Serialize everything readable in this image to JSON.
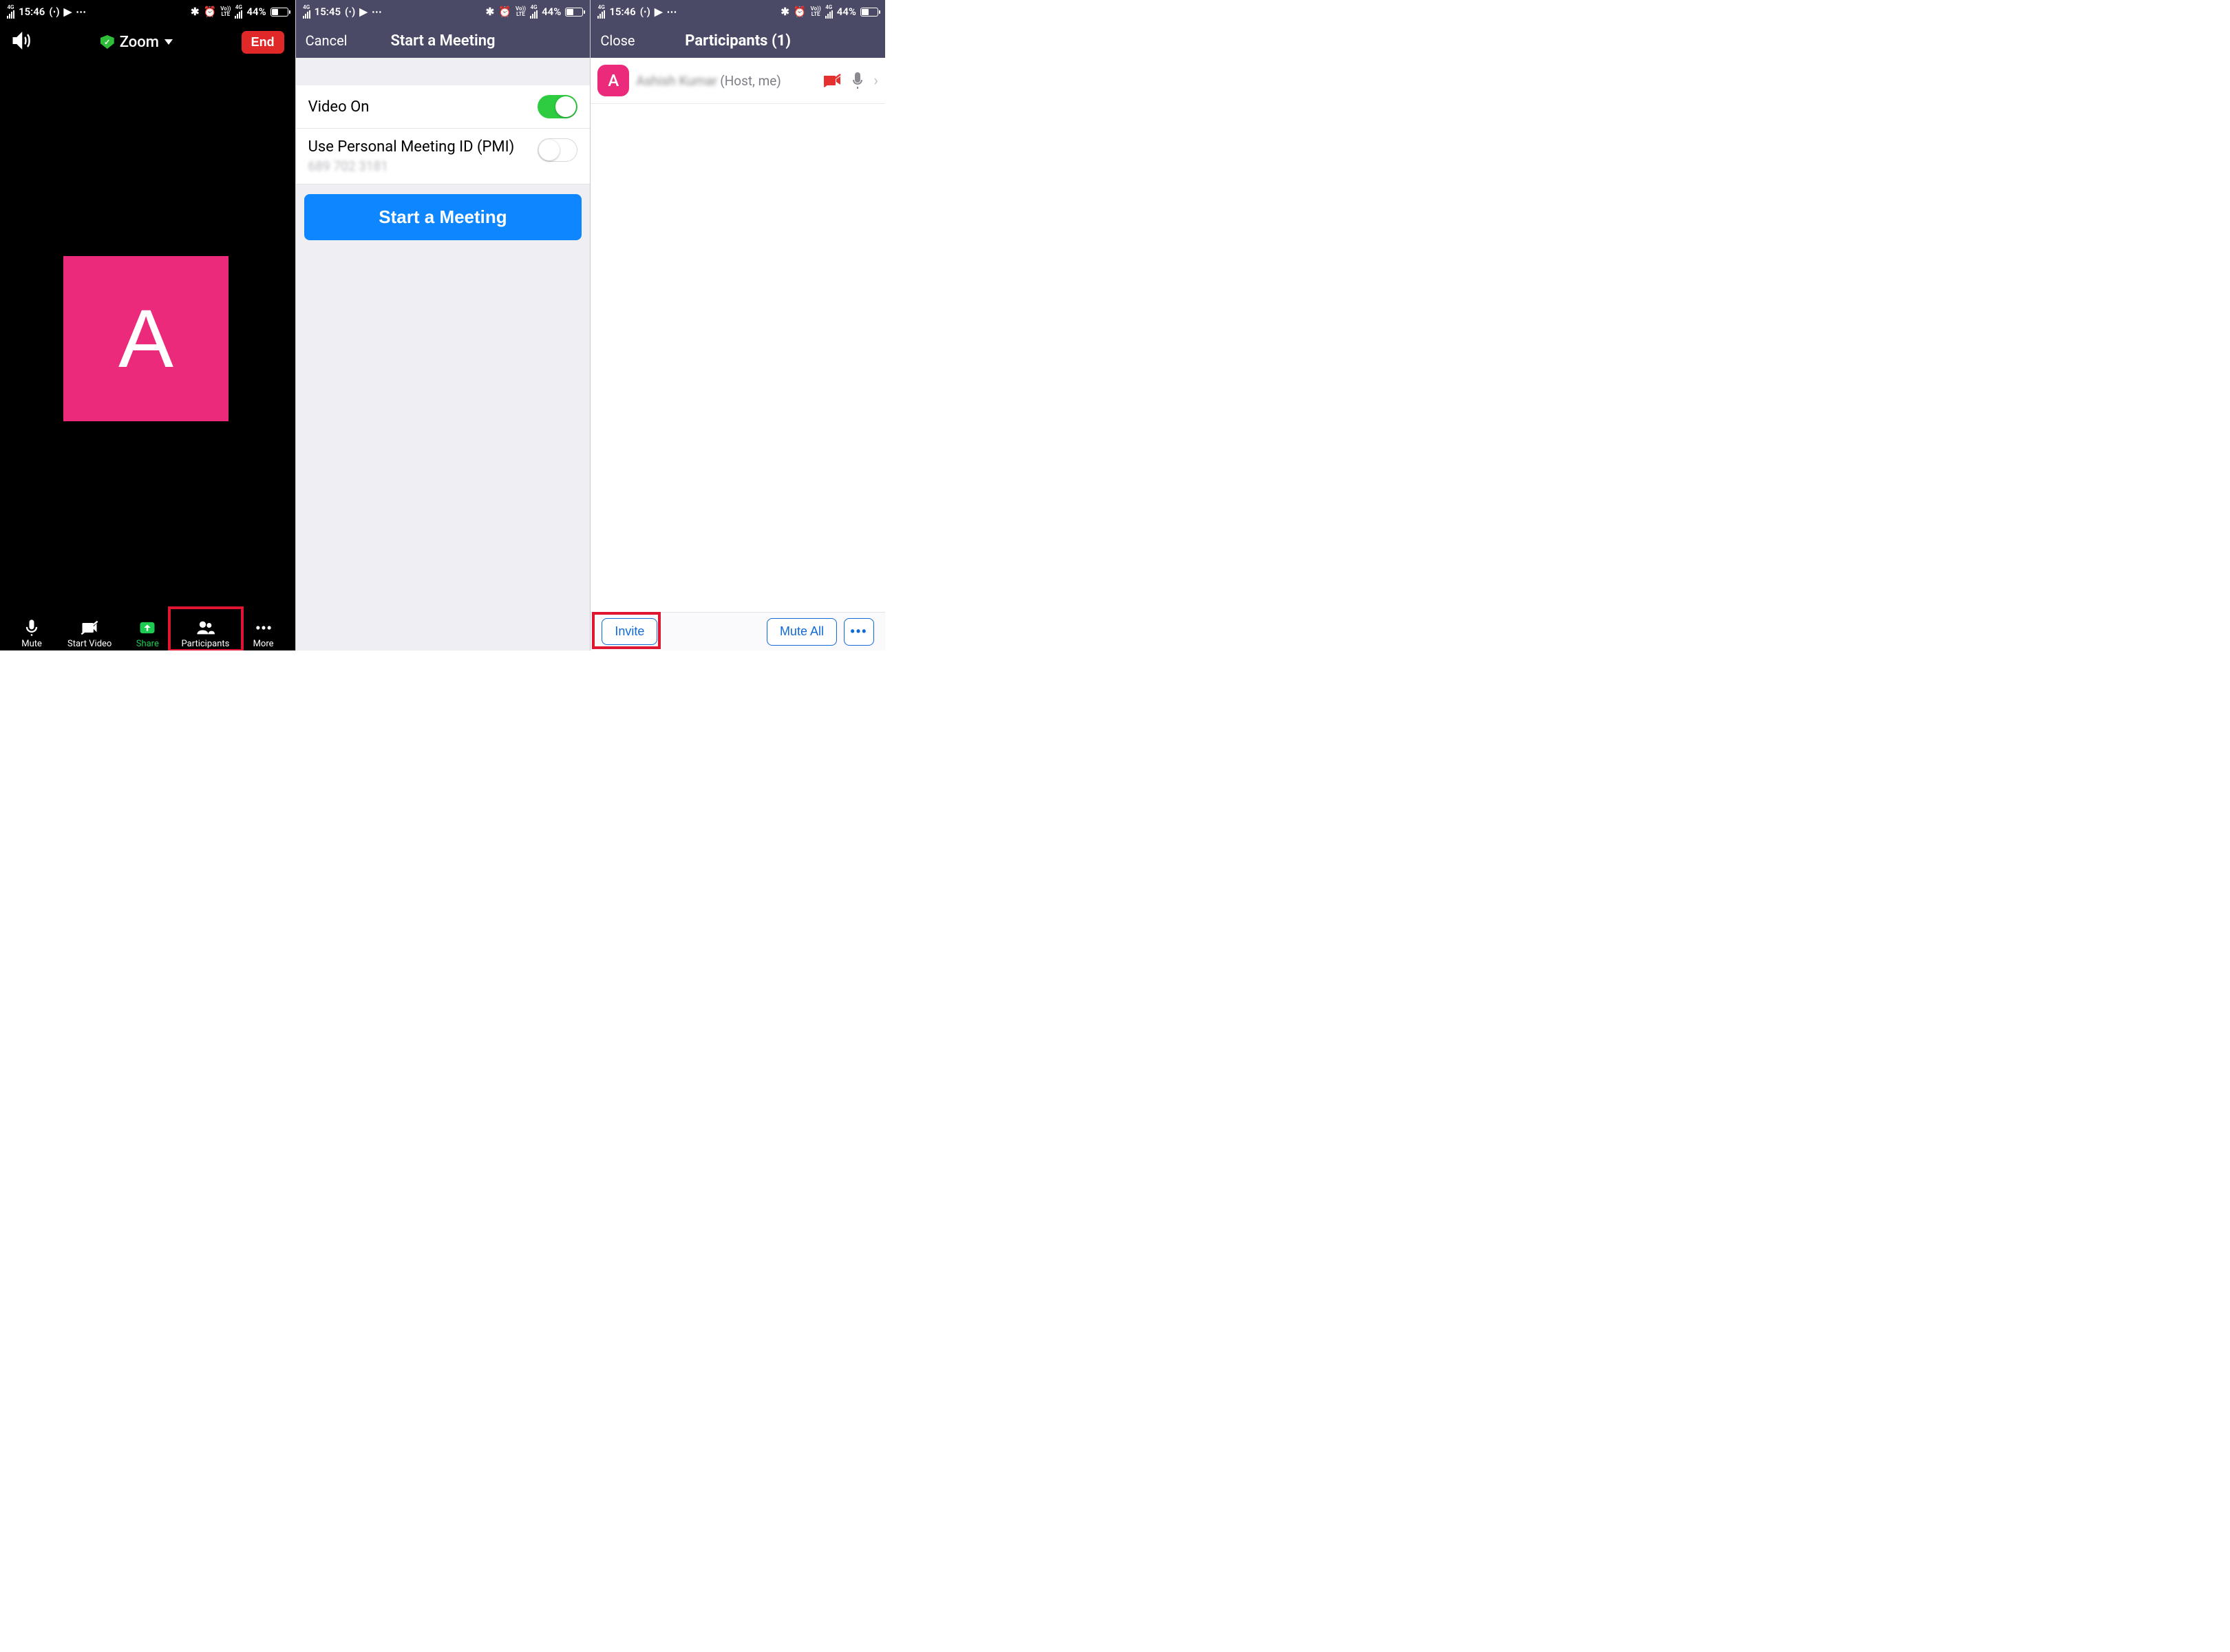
{
  "status": {
    "net_label": "4G",
    "time1": "15:46",
    "time2": "15:45",
    "time3": "15:46",
    "battery_text": "44%",
    "lte_top": "Vo))",
    "lte_bottom": "LTE",
    "net2_top": "4G"
  },
  "p1": {
    "title": "Zoom",
    "end": "End",
    "avatar_letter": "A",
    "toolbar": {
      "mute": "Mute",
      "start_video": "Start Video",
      "share": "Share",
      "participants": "Participants",
      "more": "More"
    }
  },
  "p2": {
    "cancel": "Cancel",
    "title": "Start a Meeting",
    "video_on": "Video On",
    "pmi_label": "Use Personal Meeting ID (PMI)",
    "pmi_value": "689 702 3181",
    "start_btn": "Start a Meeting"
  },
  "p3": {
    "close": "Close",
    "title": "Participants (1)",
    "avatar_letter": "A",
    "name_blurred": "Ashish Kumar",
    "role": "(Host, me)",
    "invite": "Invite",
    "mute_all": "Mute All"
  }
}
